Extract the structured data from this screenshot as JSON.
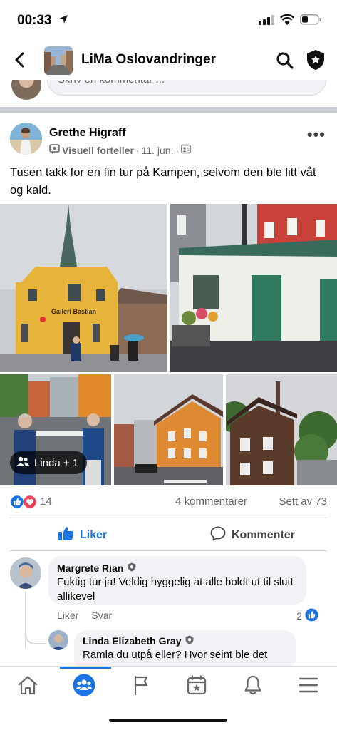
{
  "status_bar": {
    "time": "00:33"
  },
  "header": {
    "group_name": "LiMa Oslovandringer"
  },
  "previous_comment_placeholder": "Skriv en kommentar ...",
  "post": {
    "author": "Grethe Higraff",
    "badge": "Visuell forteller",
    "date": "11. jun.",
    "text": "Tusen takk for en fin tur på Kampen, selvom den ble litt våt og kald.",
    "photo_tag_label": "Linda + 1",
    "photo_sign_text": "Galleri Bastian",
    "reaction_count": "14",
    "comments_count": "4 kommentarer",
    "seen_count": "Sett av 73",
    "like_label": "Liker",
    "comment_label": "Kommenter"
  },
  "comments": [
    {
      "author": "Margrete Rian",
      "text": "Fuktig tur ja! Veldig hyggelig at alle holdt ut til slutt allikevel",
      "like_action": "Liker",
      "reply_action": "Svar",
      "likes": "2"
    },
    {
      "author": "Linda Elizabeth Gray",
      "text": "Ramla du utpå eller? Hvor seint ble det"
    }
  ],
  "tabs": [
    "home",
    "groups",
    "pages",
    "marketplace",
    "notifications",
    "menu"
  ],
  "colors": {
    "accent": "#1b74e4",
    "love": "#f33e58"
  }
}
